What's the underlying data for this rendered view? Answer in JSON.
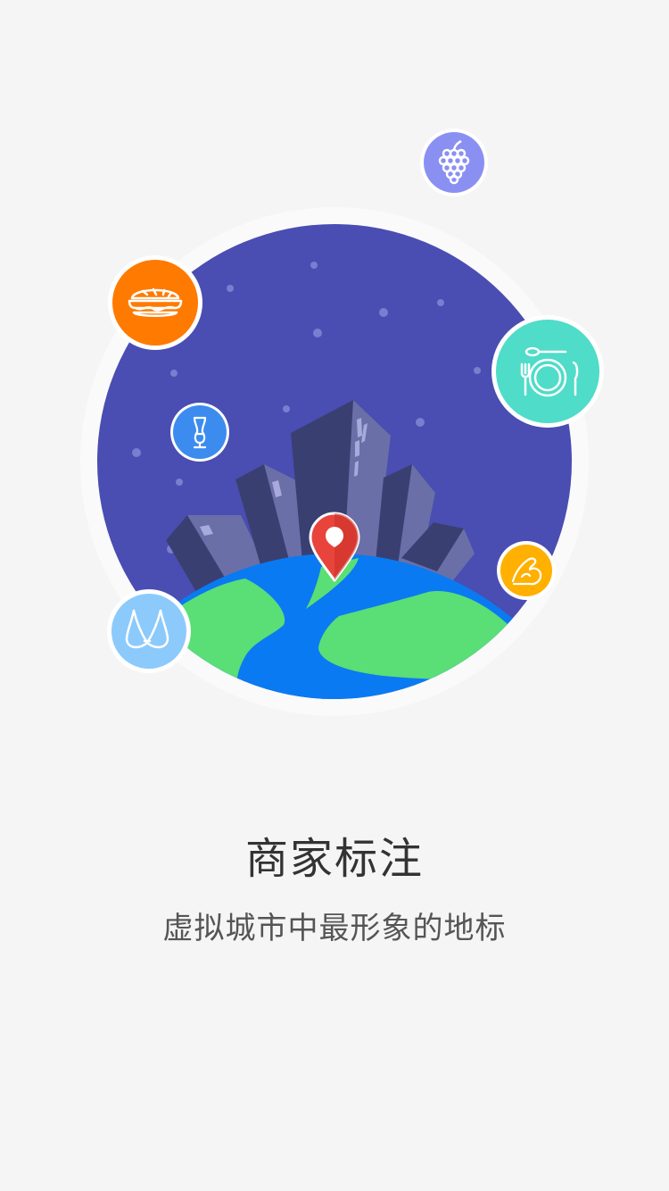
{
  "onboarding": {
    "title": "商家标注",
    "subtitle": "虚拟城市中最形象的地标"
  },
  "illustration": {
    "colors": {
      "sky": "#4a4db2",
      "ring": "#fafafa",
      "ocean": "#0a7af2",
      "land": "#5ade76",
      "pin": "#e8443b",
      "building_dark": "#3a3f72",
      "building_light": "#6b6fa8"
    },
    "badges": [
      {
        "icon": "grapes-icon",
        "color": "#8a90f2"
      },
      {
        "icon": "sandwich-icon",
        "color": "#ff7a00"
      },
      {
        "icon": "dining-icon",
        "color": "#4fdcc8"
      },
      {
        "icon": "wine-glass-icon",
        "color": "#3c8cf0"
      },
      {
        "icon": "muscle-icon",
        "color": "#ffb000"
      },
      {
        "icon": "bra-icon",
        "color": "#8ccafc"
      }
    ]
  }
}
